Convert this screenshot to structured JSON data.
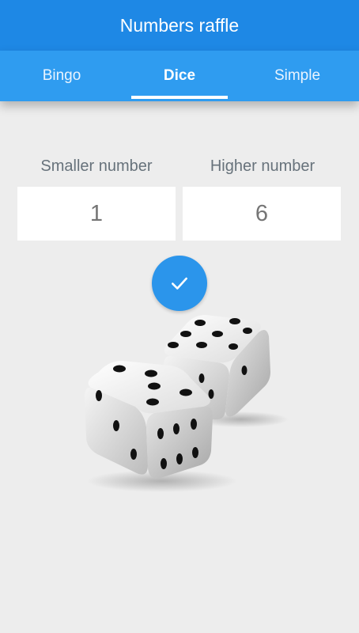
{
  "app": {
    "title": "Numbers raffle"
  },
  "tabs": [
    {
      "label": "Bingo",
      "selected": false
    },
    {
      "label": "Dice",
      "selected": true
    },
    {
      "label": "Simple",
      "selected": false
    }
  ],
  "range": {
    "min_label": "Smaller number",
    "min_value": "1",
    "max_label": "Higher number",
    "max_value": "6"
  },
  "actions": {
    "confirm_icon": "check-icon"
  },
  "illustration": {
    "icon": "dice-icon"
  },
  "colors": {
    "appbar": "#1e88e5",
    "tabbar": "#2f9cf0",
    "accent": "#2b95eb",
    "background": "#ededed"
  }
}
